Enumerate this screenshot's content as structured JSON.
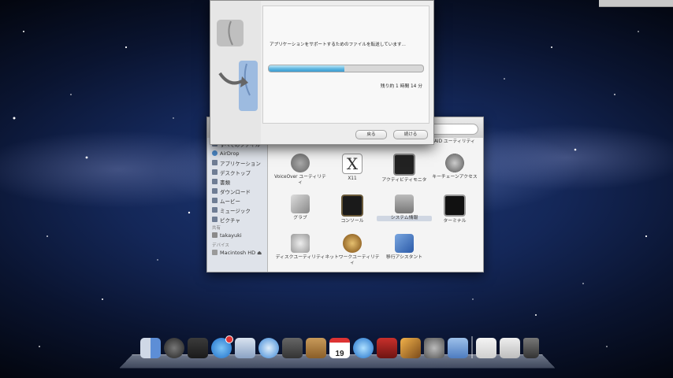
{
  "migration_dialog": {
    "message": "アプリケーションをサポートするためのファイルを転送しています...",
    "progress": 0.49,
    "time_remaining": "残り約 1 時間 14 分",
    "back_button": "戻る",
    "continue_button": "続ける"
  },
  "finder": {
    "sidebar": {
      "items": [
        {
          "label": "すべてのファイル",
          "icon": "all-files-icon"
        },
        {
          "label": "AirDrop",
          "icon": "airdrop-icon"
        },
        {
          "label": "アプリケーション",
          "icon": "applications-icon"
        },
        {
          "label": "デスクトップ",
          "icon": "desktop-icon"
        },
        {
          "label": "書類",
          "icon": "documents-icon"
        },
        {
          "label": "ダウンロード",
          "icon": "downloads-icon"
        },
        {
          "label": "ムービー",
          "icon": "movies-icon"
        },
        {
          "label": "ミュージック",
          "icon": "music-icon"
        },
        {
          "label": "ピクチャ",
          "icon": "pictures-icon"
        }
      ],
      "shared_header": "共有",
      "shared_items": [
        {
          "label": "takayuki",
          "icon": "network-computer-icon"
        }
      ],
      "devices_header": "デバイス",
      "device_items": [
        {
          "label": "Macintosh HD ⏏",
          "icon": "hard-disk-icon"
        }
      ]
    },
    "apps": [
      {
        "label": "RAID ユーティリティ",
        "icon": "raid-utility-icon",
        "selected": false
      },
      {
        "label": "VoiceOver ユーティリティ",
        "icon": "voiceover-icon",
        "selected": false
      },
      {
        "label": "X11",
        "icon": "x11-icon",
        "selected": false
      },
      {
        "label": "アクティビティモニタ",
        "icon": "activity-monitor-icon",
        "selected": false
      },
      {
        "label": "キーチェーンアクセス",
        "icon": "keychain-icon",
        "selected": false
      },
      {
        "label": "グラブ",
        "icon": "grab-icon",
        "selected": false
      },
      {
        "label": "コンソール",
        "icon": "console-icon",
        "selected": false
      },
      {
        "label": "システム情報",
        "icon": "system-information-icon",
        "selected": true
      },
      {
        "label": "ターミナル",
        "icon": "terminal-icon",
        "selected": false
      },
      {
        "label": "ディスクユーティリティ",
        "icon": "disk-utility-icon",
        "selected": false
      },
      {
        "label": "ネットワークユーティリティ",
        "icon": "network-utility-icon",
        "selected": false
      },
      {
        "label": "移行アシスタント",
        "icon": "migration-assistant-icon",
        "selected": false
      }
    ]
  },
  "dock": {
    "calendar_day": "19",
    "items": [
      "finder-icon",
      "dashboard-icon",
      "mission-control-icon",
      "app-store-icon",
      "mail-icon",
      "safari-icon",
      "facetime-icon",
      "address-book-icon",
      "calendar-icon",
      "itunes-icon",
      "photo-booth-icon",
      "iphoto-icon",
      "system-preferences-icon",
      "utilities-folder-icon",
      "documents-stack-icon",
      "downloads-stack-icon",
      "trash-icon"
    ]
  },
  "colors": {
    "progress": "#5eb6e0",
    "badge": "#dd3333"
  }
}
